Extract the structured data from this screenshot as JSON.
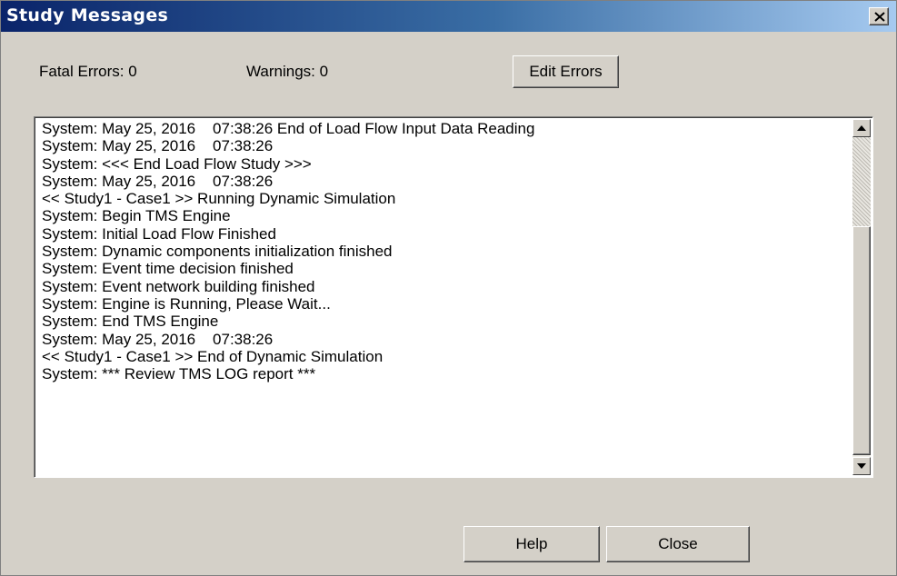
{
  "window": {
    "title": "Study Messages"
  },
  "counts": {
    "fatal_errors_label": "Fatal Errors:  0",
    "warnings_label": "Warnings:  0"
  },
  "buttons": {
    "edit_errors": "Edit Errors",
    "help": "Help",
    "close": "Close"
  },
  "messages": [
    "System: May 25, 2016    07:38:26 End of Load Flow Input Data Reading",
    "System: May 25, 2016    07:38:26",
    "System: <<< End Load Flow Study >>>",
    "System: May 25, 2016    07:38:26",
    "<< Study1 - Case1 >> Running Dynamic Simulation",
    "System: Begin TMS Engine",
    "System: Initial Load Flow Finished",
    "System: Dynamic components initialization finished",
    "System: Event time decision finished",
    "System: Event network building finished",
    "System: Engine is Running, Please Wait...",
    "System: End TMS Engine",
    "System: May 25, 2016    07:38:26",
    "<< Study1 - Case1 >> End of Dynamic Simulation",
    "System: *** Review TMS LOG report ***"
  ],
  "icons": {
    "close": "close-icon",
    "scroll_up": "arrow-up-icon",
    "scroll_down": "arrow-down-icon"
  },
  "colors": {
    "titlebar_start": "#0a246a",
    "titlebar_end": "#a6caf0",
    "dialog_face": "#d4d0c8",
    "list_background": "#ffffff"
  }
}
